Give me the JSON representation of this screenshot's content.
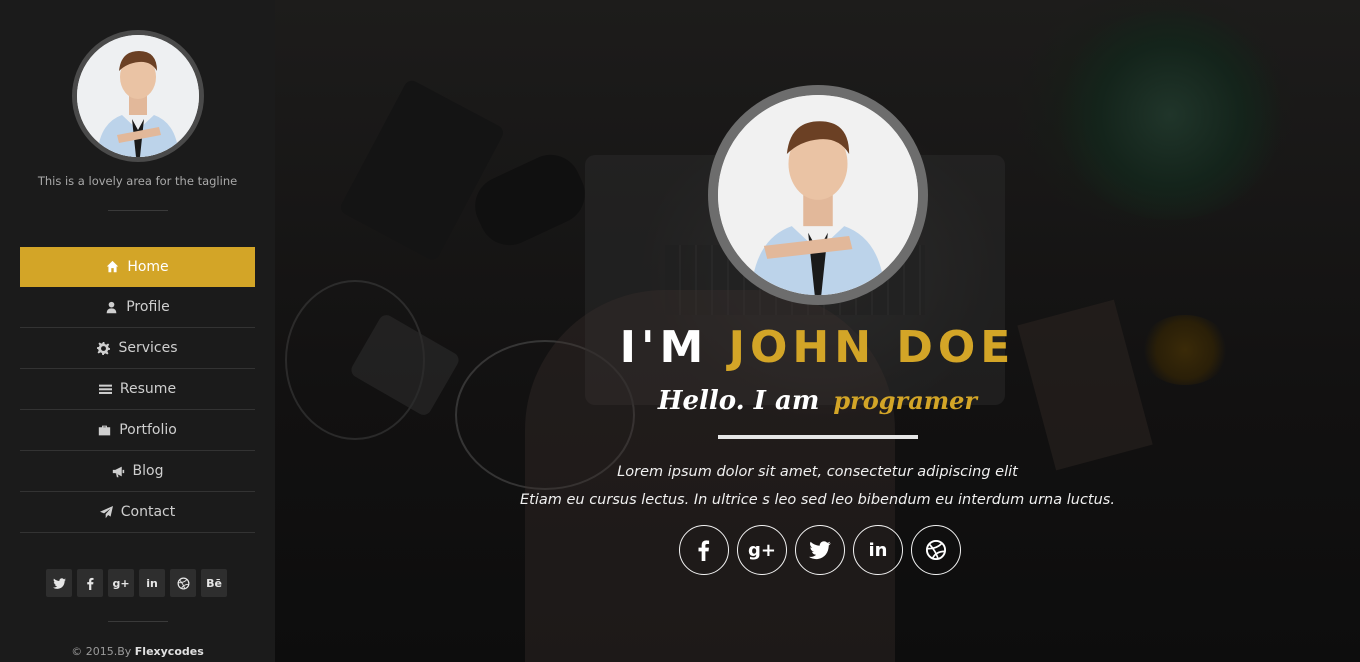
{
  "sidebar": {
    "tagline": "This is a lovely area for the tagline",
    "nav": [
      {
        "label": "Home",
        "icon": "home-icon",
        "active": true
      },
      {
        "label": "Profile",
        "icon": "user-icon"
      },
      {
        "label": "Services",
        "icon": "gear-icon"
      },
      {
        "label": "Resume",
        "icon": "list-icon"
      },
      {
        "label": "Portfolio",
        "icon": "briefcase-icon"
      },
      {
        "label": "Blog",
        "icon": "megaphone-icon"
      },
      {
        "label": "Contact",
        "icon": "paper-plane-icon"
      }
    ],
    "socials": [
      {
        "icon": "twitter-icon"
      },
      {
        "icon": "facebook-icon"
      },
      {
        "icon": "google-plus-icon",
        "text": "g+"
      },
      {
        "icon": "linkedin-icon",
        "text": "in"
      },
      {
        "icon": "dribbble-icon"
      },
      {
        "icon": "behance-icon",
        "text": "Bē"
      }
    ],
    "copyright_prefix": "© 2015.By",
    "copyright_brand": "Flexycodes"
  },
  "hero": {
    "title_prefix": "I'M",
    "title_name": "JOHN DOE",
    "hello": "Hello. I am",
    "role": "programer",
    "desc_line1": "Lorem ipsum dolor sit amet, consectetur adipiscing elit",
    "desc_line2": "Etiam eu cursus lectus. In ultrice s leo sed leo bibendum eu interdum urna luctus.",
    "socials": [
      {
        "icon": "facebook-icon"
      },
      {
        "icon": "google-plus-icon",
        "text": "g+"
      },
      {
        "icon": "twitter-icon"
      },
      {
        "icon": "linkedin-icon",
        "text": "in"
      },
      {
        "icon": "dribbble-icon"
      }
    ]
  },
  "colors": {
    "accent": "#d3a527",
    "sidebar": "#1b1b1b"
  }
}
